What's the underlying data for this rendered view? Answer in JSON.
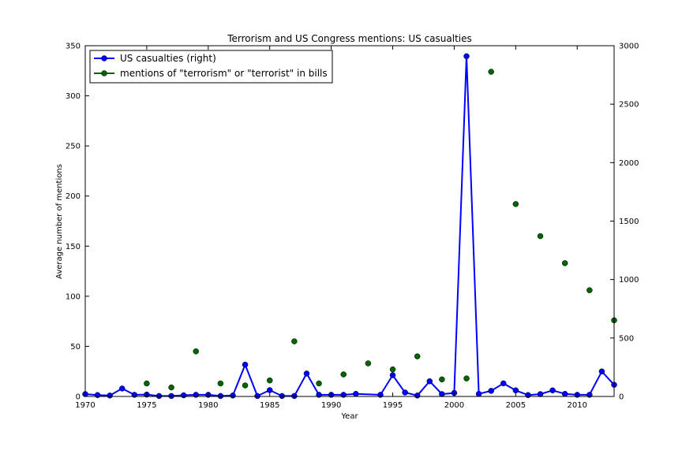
{
  "chart_data": {
    "type": "line",
    "title": "Terrorism and US Congress mentions: US casualties",
    "xlabel": "Year",
    "ylabel": "Average number of mentions",
    "y2label": "",
    "xlim": [
      1970,
      2013
    ],
    "ylim": [
      0,
      350
    ],
    "y2lim": [
      0,
      3000
    ],
    "x_ticks": [
      "1970",
      "1975",
      "1980",
      "1985",
      "1990",
      "1995",
      "2000",
      "2005",
      "2010"
    ],
    "y_ticks": [
      "0",
      "50",
      "100",
      "150",
      "200",
      "250",
      "300",
      "350"
    ],
    "y2_ticks": [
      "0",
      "500",
      "1000",
      "1500",
      "2000",
      "2500",
      "3000"
    ],
    "grid": false,
    "legend_placement": "top-left",
    "series": [
      {
        "name": "US casualties (right)",
        "color": "#0000ff",
        "style": "line-with-markers",
        "axis": "right",
        "x": [
          1970,
          1971,
          1972,
          1973,
          1974,
          1975,
          1976,
          1977,
          1978,
          1979,
          1980,
          1981,
          1982,
          1983,
          1984,
          1985,
          1986,
          1987,
          1988,
          1989,
          1990,
          1991,
          1992,
          1994,
          1995,
          1996,
          1997,
          1998,
          1999,
          2000,
          2001,
          2002,
          2003,
          2004,
          2005,
          2006,
          2007,
          2008,
          2009,
          2010,
          2011,
          2012,
          2013
        ],
        "values": [
          20,
          12,
          8,
          68,
          14,
          16,
          4,
          4,
          10,
          14,
          14,
          4,
          8,
          272,
          4,
          54,
          4,
          4,
          196,
          14,
          14,
          14,
          22,
          14,
          182,
          34,
          8,
          130,
          20,
          30,
          2910,
          22,
          48,
          112,
          52,
          12,
          20,
          52,
          22,
          14,
          14,
          214,
          100
        ]
      },
      {
        "name": "mentions of \"terrorism\" or \"terrorist\" in bills",
        "color": "#006400",
        "style": "markers",
        "axis": "left",
        "x": [
          1975,
          1977,
          1979,
          1981,
          1983,
          1985,
          1987,
          1989,
          1991,
          1993,
          1995,
          1997,
          1999,
          2001,
          2003,
          2005,
          2007,
          2009,
          2011,
          2013
        ],
        "values": [
          13,
          9,
          45,
          13,
          11,
          16,
          55,
          13,
          22,
          33,
          27,
          40,
          17,
          18,
          324,
          192,
          160,
          133,
          106,
          76
        ]
      }
    ]
  }
}
